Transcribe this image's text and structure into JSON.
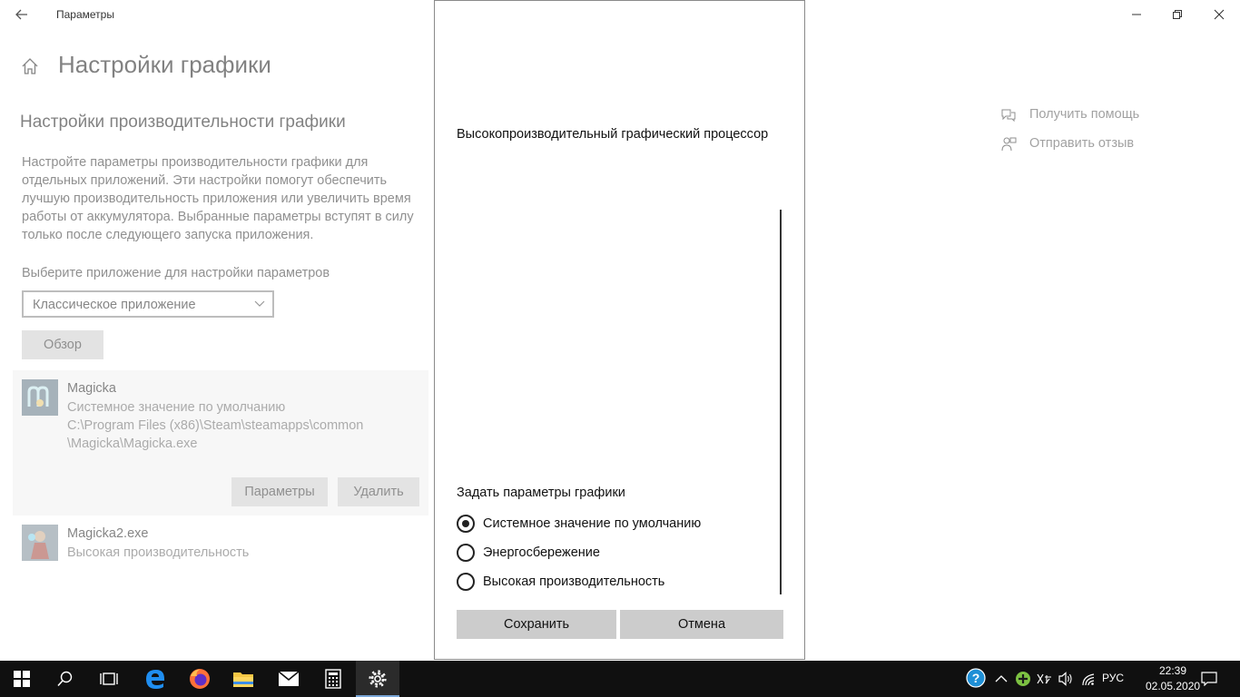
{
  "window": {
    "title": "Параметры",
    "controls": [
      "minimize-icon",
      "restore-icon",
      "close-icon"
    ]
  },
  "page": {
    "title": "Настройки графики",
    "section_title": "Настройки производительности графики",
    "description_lines": [
      "Настройте параметры производительности графики для",
      "отдельных приложений. Эти настройки помогут обеспечить",
      "лучшую производительность приложения или увеличить время",
      "работы от аккумулятора. Выбранные параметры вступят в силу",
      "только после следующего запуска приложения."
    ],
    "select_label": "Выберите приложение для настройки параметров",
    "dropdown_value": "Классическое приложение",
    "browse_label": "Обзор"
  },
  "apps": [
    {
      "name": "Magicka",
      "mode": "Системное значение по умолчанию",
      "path_line1": "C:\\Program Files (x86)\\Steam\\steamapps\\common",
      "path_line2": "\\Magicka\\Magicka.exe",
      "options_label": "Параметры",
      "remove_label": "Удалить"
    },
    {
      "name": "Magicka2.exe",
      "mode": "Высокая производительность"
    }
  ],
  "help": {
    "get_help": "Получить помощь",
    "feedback": "Отправить отзыв"
  },
  "dialog": {
    "gpu_text": "Высокопроизводительный графический процессор",
    "options_label": "Задать параметры графики",
    "options": [
      {
        "label": "Системное значение по умолчанию",
        "checked": true
      },
      {
        "label": "Энергосбережение",
        "checked": false
      },
      {
        "label": "Высокая производительность",
        "checked": false
      }
    ],
    "save_label": "Сохранить",
    "cancel_label": "Отмена"
  },
  "taskbar": {
    "apps": [
      "windows-start-icon",
      "search-icon",
      "task-view-icon",
      "edge-icon",
      "firefox-icon",
      "file-explorer-icon",
      "mail-icon",
      "calculator-icon",
      "settings-icon"
    ],
    "active_app": "settings-icon",
    "language": "РУС",
    "time": "22:39",
    "date": "02.05.2020",
    "colors": {
      "taskbar_bg": "#101010",
      "active_indicator": "#7aa7d8"
    }
  }
}
